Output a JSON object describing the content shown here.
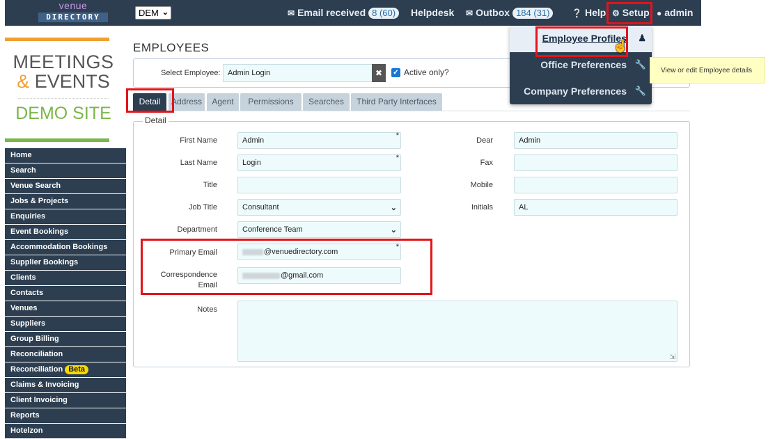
{
  "topbar": {
    "logo_line1": "venue",
    "logo_line2": "DIRECTORY",
    "company_select": "DEM",
    "email_label": "Email received",
    "email_count": "8 (60)",
    "helpdesk_label": "Helpdesk",
    "outbox_label": "Outbox",
    "outbox_count": "184 (31)",
    "help_label": "Help",
    "setup_label": "Setup",
    "user_label": "admin"
  },
  "dropdown": {
    "items": [
      {
        "label": "Employee Profiles",
        "icon": "users-icon"
      },
      {
        "label": "Office Preferences",
        "icon": "wrench-icon"
      },
      {
        "label": "Company Preferences",
        "icon": "wrench-icon"
      }
    ],
    "tooltip": "View or edit Employee details"
  },
  "brand": {
    "line1": "MEETINGS",
    "line2_amp": "&",
    "line2": "EVENTS",
    "line3": "DEMO SITE",
    "colors": {
      "orange": "#f0a030",
      "green": "#7ab648"
    }
  },
  "sidebar": {
    "items": [
      "Home",
      "Search",
      "Venue Search",
      "Jobs & Projects",
      "Enquiries",
      "Event Bookings",
      "Accommodation Bookings",
      "Supplier Bookings",
      "Clients",
      "Contacts",
      "Venues",
      "Suppliers",
      "Group Billing",
      "Reconciliation",
      "Reconciliation",
      "Claims & Invoicing",
      "Client Invoicing",
      "Reports",
      "Hotelzon"
    ],
    "beta_label": "Beta"
  },
  "main": {
    "title": "EMPLOYEES",
    "select_label": "Select Employee:",
    "select_value": "Admin Login",
    "active_only_label": "Active only?",
    "tabs": [
      "Detail",
      "Address",
      "Agent",
      "Permissions",
      "Searches",
      "Third Party Interfaces"
    ],
    "legend": "Detail",
    "fields": {
      "first_name": {
        "label": "First Name",
        "value": "Admin"
      },
      "last_name": {
        "label": "Last Name",
        "value": "Login"
      },
      "title": {
        "label": "Title",
        "value": ""
      },
      "job_title": {
        "label": "Job Title",
        "value": "Consultant"
      },
      "department": {
        "label": "Department",
        "value": "Conference Team"
      },
      "primary_email": {
        "label": "Primary Email",
        "value": "@venuedirectory.com"
      },
      "correspondence_email": {
        "label": "Correspondence Email",
        "value": "@gmail.com"
      },
      "notes": {
        "label": "Notes",
        "value": ""
      },
      "dear": {
        "label": "Dear",
        "value": "Admin"
      },
      "fax": {
        "label": "Fax",
        "value": ""
      },
      "mobile": {
        "label": "Mobile",
        "value": ""
      },
      "initials": {
        "label": "Initials",
        "value": "AL"
      }
    },
    "required_mark": "*"
  },
  "colors": {
    "navy": "#2c3e50",
    "highlight": "#e3141b",
    "input_bg": "#eefbfc",
    "tab_bg": "#c7d3dc"
  }
}
